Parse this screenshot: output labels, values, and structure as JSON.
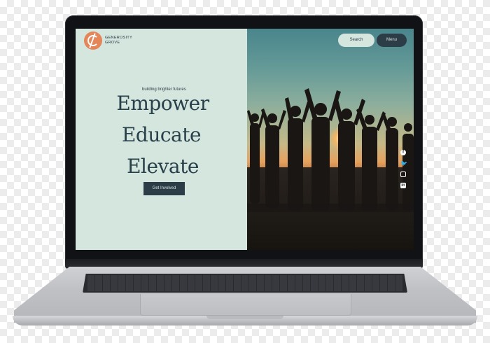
{
  "brand": {
    "name_line1": "GENEROSITY",
    "name_line2": "GROVE",
    "logo_icon": "globe-leaf-icon",
    "logo_color": "#e4855a"
  },
  "nav": {
    "search_label": "Search",
    "menu_label": "Menu"
  },
  "hero": {
    "tagline": "building brighter futures",
    "headline_1": "Empower",
    "headline_2": "Educate",
    "headline_3": "Elevate",
    "cta_label": "Get Involved",
    "image_alt_icon": "crowd-sunset-photo"
  },
  "social": {
    "facebook": "f",
    "twitter": "t",
    "instagram": "",
    "linkedin": "in"
  },
  "colors": {
    "panel_bg": "#d5e6df",
    "accent_dark": "#2c3d48"
  }
}
